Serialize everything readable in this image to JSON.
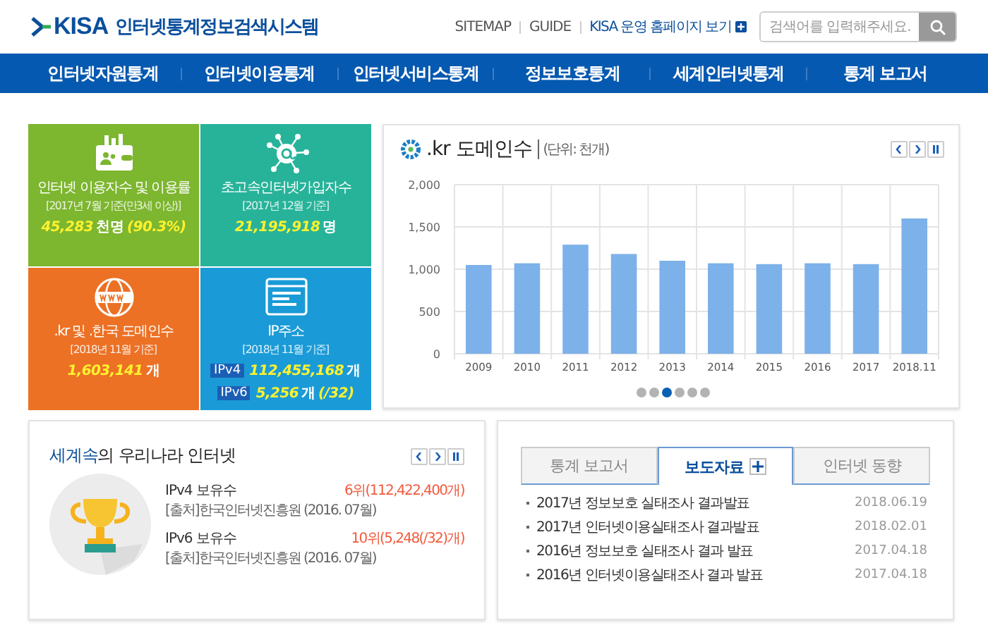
{
  "header": {
    "logo_mark": "KISA",
    "logo_title": "인터넷통계정보검색시스템",
    "links": [
      "SITEMAP",
      "GUIDE"
    ],
    "home_link": "KISA 운영 홈페이지 보기",
    "search": {
      "placeholder": "검색어를 입력해주세요."
    }
  },
  "nav": [
    "인터넷자원통계",
    "인터넷이용통계",
    "인터넷서비스통계",
    "정보보호통계",
    "세계인터넷통계",
    "통계 보고서"
  ],
  "tiles": [
    {
      "kind": "wallet",
      "color": "#7db62f",
      "title": "인터넷 이용자수 및 이용률",
      "sub": "[2017년 7월 기준(만3세 이상)]",
      "lines": [
        {
          "parts": [
            {
              "kind": "number",
              "text": "45,283"
            },
            {
              "kind": "unit",
              "text": "천명"
            },
            {
              "kind": "number",
              "text": "(90.3%)"
            }
          ]
        }
      ]
    },
    {
      "kind": "network",
      "color": "#27b39a",
      "title": "초고속인터넷가입자수",
      "sub": "[2017년 12월 기준]",
      "lines": [
        {
          "parts": [
            {
              "kind": "number",
              "text": "21,195,918"
            },
            {
              "kind": "unit",
              "text": "명"
            }
          ]
        }
      ]
    },
    {
      "kind": "globe",
      "color": "#ec7125",
      "title": ".kr 및 .한국 도메인수",
      "sub": "[2018년 11월 기준]",
      "lines": [
        {
          "parts": [
            {
              "kind": "number",
              "text": "1,603,141"
            },
            {
              "kind": "unit",
              "text": "개"
            }
          ]
        }
      ]
    },
    {
      "kind": "browser",
      "color": "#1a9bd7",
      "title": "IP주소",
      "sub": "[2018년 11월 기준]",
      "lines": [
        {
          "badge": "IPv4",
          "parts": [
            {
              "kind": "number",
              "text": "112,455,168"
            },
            {
              "kind": "unit",
              "text": "개"
            }
          ]
        },
        {
          "badge": "IPv6",
          "parts": [
            {
              "kind": "number",
              "text": "5,256"
            },
            {
              "kind": "unit",
              "text": "개"
            },
            {
              "kind": "number",
              "text": "(/32)"
            }
          ]
        }
      ]
    }
  ],
  "chart_panel": {
    "title": ".kr 도메인수",
    "unit": "(단위: 천개)",
    "chart_data": {
      "type": "bar",
      "categories": [
        "2009",
        "2010",
        "2011",
        "2012",
        "2013",
        "2014",
        "2015",
        "2016",
        "2017",
        "2018.11"
      ],
      "values": [
        1050,
        1070,
        1290,
        1180,
        1100,
        1070,
        1060,
        1070,
        1060,
        1600
      ],
      "grid": true,
      "ylim": [
        0,
        2000
      ],
      "yticks": [
        {
          "value": 0,
          "label": "0"
        },
        {
          "value": 500,
          "label": "500"
        },
        {
          "value": 1000,
          "label": "1,000"
        },
        {
          "value": 1500,
          "label": "1,500"
        },
        {
          "value": 2000,
          "label": "2,000"
        }
      ]
    },
    "pager": [
      {
        "selected": false
      },
      {
        "selected": false
      },
      {
        "selected": true
      },
      {
        "selected": false
      },
      {
        "selected": false
      },
      {
        "selected": false
      }
    ]
  },
  "world_panel": {
    "title_highlight": "세계속",
    "title_rest": "의 우리나라 인터넷",
    "rows": [
      {
        "label": "IPv4 보유수",
        "source": "[출처]한국인터넷진흥원 (2016. 07월)",
        "rank": "6위(112,422,400개)"
      },
      {
        "label": "IPv6 보유수",
        "source": "[출처]한국인터넷진흥원 (2016. 07월)",
        "rank": "10위(5,248(/32)개)"
      }
    ]
  },
  "news_panel": {
    "tabs": [
      {
        "label": "통계 보고서",
        "selected": false
      },
      {
        "label": "보도자료",
        "selected": true
      },
      {
        "label": "인터넷 동향",
        "selected": false
      }
    ],
    "items": [
      {
        "title": "2017년 정보보호 실태조사 결과발표",
        "date": "2018.06.19"
      },
      {
        "title": "2017년 인터넷이용실태조사 결과발표",
        "date": "2018.02.01"
      },
      {
        "title": "2016년 정보보호 실태조사 결과 발표",
        "date": "2017.04.18"
      },
      {
        "title": "2016년 인터넷이용실태조사 결과 발표",
        "date": "2017.04.18"
      }
    ]
  }
}
